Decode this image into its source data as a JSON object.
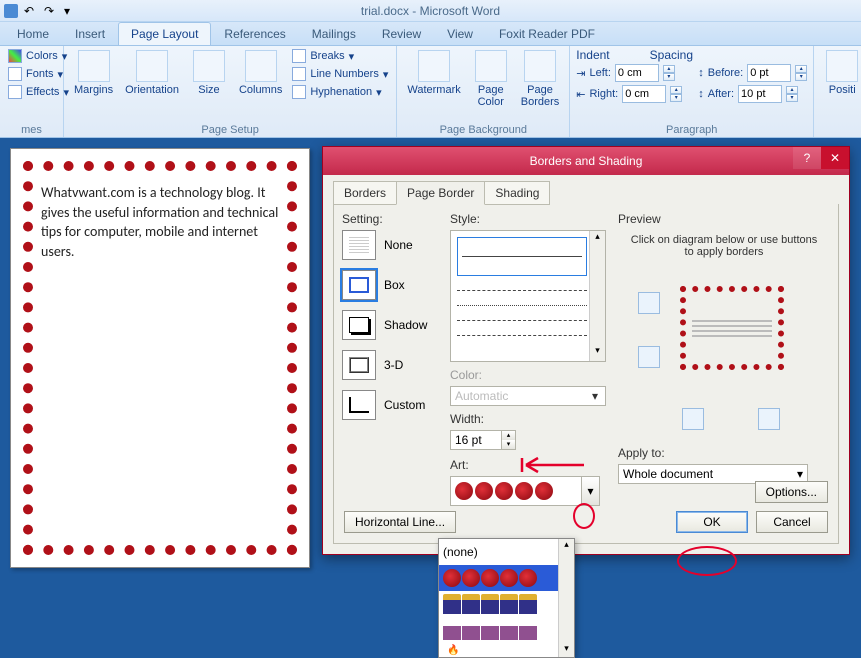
{
  "titlebar": {
    "title": "trial.docx - Microsoft Word"
  },
  "ribbon": {
    "tabs": [
      "Home",
      "Insert",
      "Page Layout",
      "References",
      "Mailings",
      "Review",
      "View",
      "Foxit Reader PDF"
    ],
    "themes": {
      "colors": "Colors",
      "fonts": "Fonts",
      "effects": "Effects",
      "group": "mes"
    },
    "pagesetup": {
      "margins": "Margins",
      "orientation": "Orientation",
      "size": "Size",
      "columns": "Columns",
      "breaks": "Breaks",
      "linenumbers": "Line Numbers",
      "hyphenation": "Hyphenation",
      "group": "Page Setup"
    },
    "pagebg": {
      "watermark": "Watermark",
      "pagecolor": "Page\nColor",
      "pageborders": "Page\nBorders",
      "group": "Page Background"
    },
    "paragraph": {
      "indent": "Indent",
      "spacing": "Spacing",
      "left_lbl": "Left:",
      "left_val": "0 cm",
      "right_lbl": "Right:",
      "right_val": "0 cm",
      "before_lbl": "Before:",
      "before_val": "0 pt",
      "after_lbl": "After:",
      "after_val": "10 pt",
      "group": "Paragraph"
    },
    "arrange": {
      "position": "Positi"
    }
  },
  "doc": {
    "text": "Whatvwant.com is a technology blog. It gives the useful information and technical tips for computer, mobile and internet users."
  },
  "dialog": {
    "title": "Borders and Shading",
    "tabs": {
      "borders": "Borders",
      "pageborder": "Page Border",
      "shading": "Shading"
    },
    "setting": {
      "label": "Setting:",
      "none": "None",
      "box": "Box",
      "shadow": "Shadow",
      "threed": "3-D",
      "custom": "Custom"
    },
    "style": {
      "label": "Style:"
    },
    "color": {
      "label": "Color:",
      "value": "Automatic"
    },
    "width": {
      "label": "Width:",
      "value": "16 pt"
    },
    "art": {
      "label": "Art:",
      "none_option": "(none)"
    },
    "preview": {
      "label": "Preview",
      "hint": "Click on diagram below or use buttons to apply borders"
    },
    "applyto": {
      "label": "Apply to:",
      "value": "Whole document"
    },
    "buttons": {
      "hline": "Horizontal Line...",
      "options": "Options...",
      "ok": "OK",
      "cancel": "Cancel"
    }
  }
}
